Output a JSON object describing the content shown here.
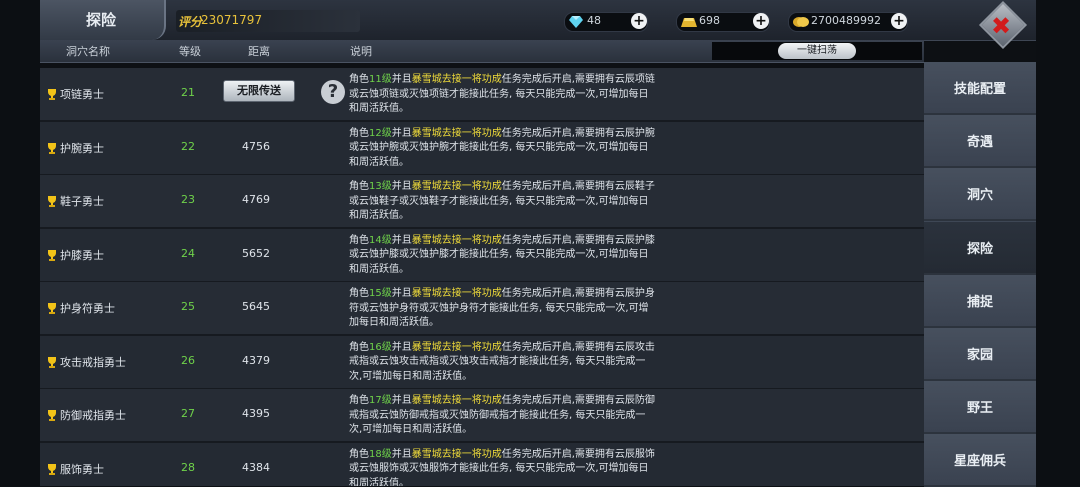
{
  "header": {
    "title": "探险",
    "score_label": "评分",
    "score_value": "23071797"
  },
  "currencies": [
    {
      "icon": "diamond-icon",
      "value": "48"
    },
    {
      "icon": "gold-bar-icon",
      "value": "698"
    },
    {
      "icon": "coin-icon",
      "value": "2700489992"
    }
  ],
  "columns": {
    "name": "洞穴名称",
    "level": "等级",
    "distance": "距离",
    "description": "说明",
    "scan_button": "一键扫荡"
  },
  "teleport_label": "无限传送",
  "rows": [
    {
      "name": "项链勇士",
      "level": "21",
      "distance": "",
      "lvl_text": "11级",
      "line1_tail": "任务完成后开启,需要拥有云辰项链",
      "line2": "或云蚀项链或灭蚀项链才能接此任务,  每天只能完成一次,可增加每日",
      "line3": "和周活跃值。"
    },
    {
      "name": "护腕勇士",
      "level": "22",
      "distance": "4756",
      "lvl_text": "12级",
      "line1_tail": "任务完成后开启,需要拥有云辰护腕",
      "line2": "或云蚀护腕或灭蚀护腕才能接此任务,  每天只能完成一次,可增加每日",
      "line3": "和周活跃值。"
    },
    {
      "name": "鞋子勇士",
      "level": "23",
      "distance": "4769",
      "lvl_text": "13级",
      "line1_tail": "任务完成后开启,需要拥有云辰鞋子",
      "line2": "或云蚀鞋子或灭蚀鞋子才能接此任务,  每天只能完成一次,可增加每日",
      "line3": "和周活跃值。"
    },
    {
      "name": "护膝勇士",
      "level": "24",
      "distance": "5652",
      "lvl_text": "14级",
      "line1_tail": "任务完成后开启,需要拥有云辰护膝",
      "line2": "或云蚀护膝或灭蚀护膝才能接此任务,  每天只能完成一次,可增加每日",
      "line3": "和周活跃值。"
    },
    {
      "name": "护身符勇士",
      "level": "25",
      "distance": "5645",
      "lvl_text": "15级",
      "line1_tail": "任务完成后开启,需要拥有云辰护身",
      "line2": "符或云蚀护身符或灭蚀护身符才能接此任务,  每天只能完成一次,可增",
      "line3": "加每日和周活跃值。"
    },
    {
      "name": "攻击戒指勇士",
      "level": "26",
      "distance": "4379",
      "lvl_text": "16级",
      "line1_tail": "任务完成后开启,需要拥有云辰攻击",
      "line2": "戒指或云蚀攻击戒指或灭蚀攻击戒指才能接此任务,  每天只能完成一",
      "line3": "次,可增加每日和周活跃值。"
    },
    {
      "name": "防御戒指勇士",
      "level": "27",
      "distance": "4395",
      "lvl_text": "17级",
      "line1_tail": "任务完成后开启,需要拥有云辰防御",
      "line2": "戒指或云蚀防御戒指或灭蚀防御戒指才能接此任务,  每天只能完成一",
      "line3": "次,可增加每日和周活跃值。"
    },
    {
      "name": "服饰勇士",
      "level": "28",
      "distance": "4384",
      "lvl_text": "18级",
      "line1_tail": "任务完成后开启,需要拥有云辰服饰",
      "line2": "或云蚀服饰或灭蚀服饰才能接此任务,  每天只能完成一次,可增加每日",
      "line3": "和周活跃值。"
    }
  ],
  "desc_common": {
    "prefix": "角色",
    "mid": "并且",
    "quest": "暴雪城去接一将功成"
  },
  "sidebar": {
    "items": [
      {
        "label": "技能配置"
      },
      {
        "label": "奇遇"
      },
      {
        "label": "洞穴"
      },
      {
        "label": "探险"
      },
      {
        "label": "捕捉"
      },
      {
        "label": "家园"
      },
      {
        "label": "野王"
      },
      {
        "label": "星座佣兵"
      }
    ]
  },
  "colors": {
    "level_green": "#6fd24a",
    "quest_yellow": "#f0dc3a",
    "score_gold": "#e8c23b",
    "close_red": "#d21b1b"
  }
}
